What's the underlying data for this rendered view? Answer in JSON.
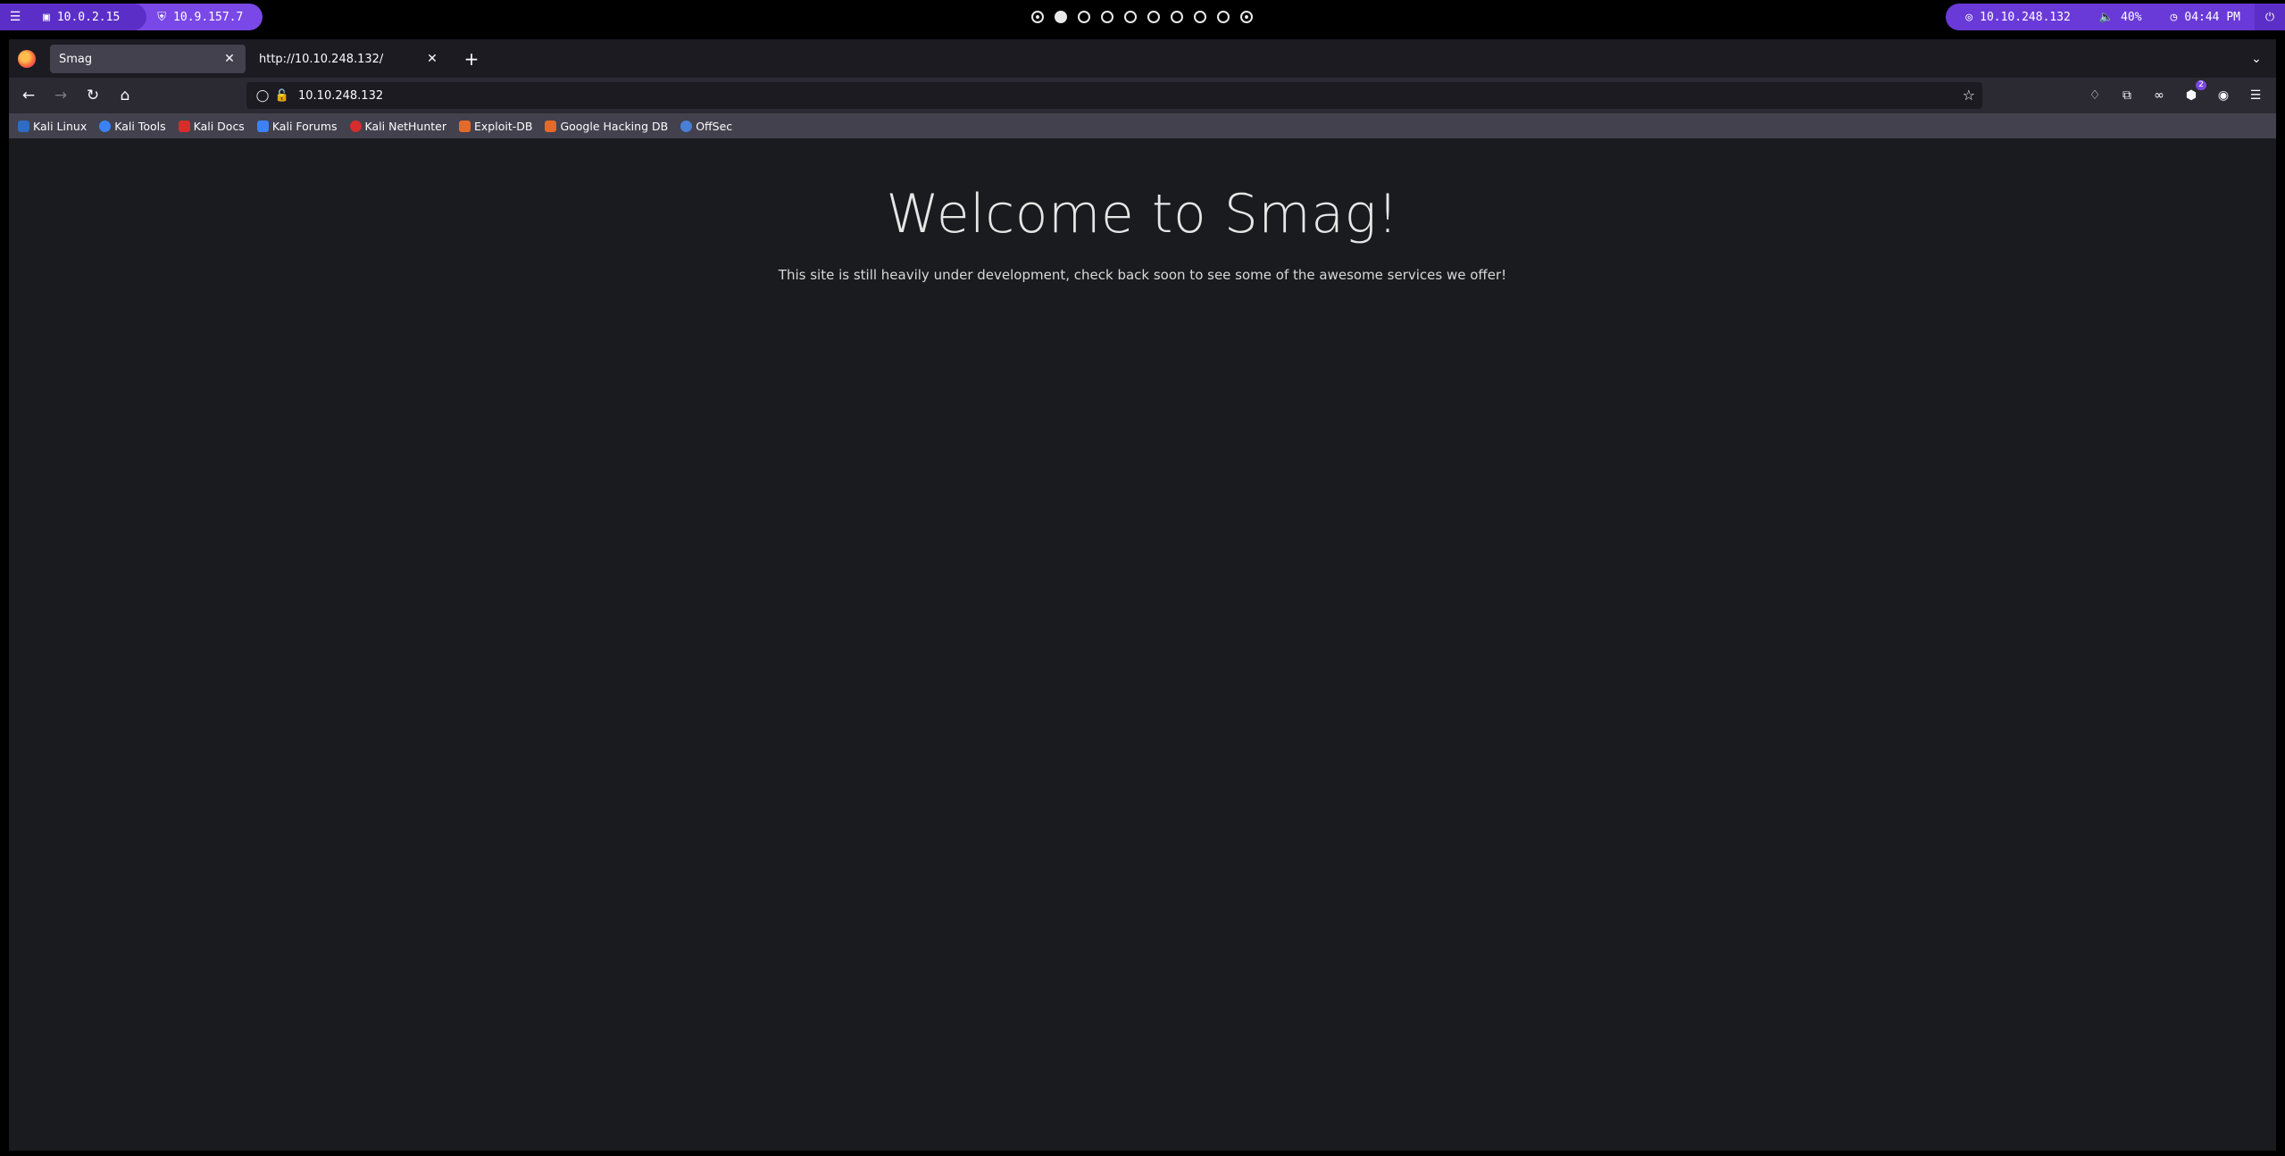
{
  "system_bar": {
    "local_ip": "10.0.2.15",
    "vpn_ip": "10.9.157.7",
    "workspaces": [
      "1",
      "2",
      "3",
      "4",
      "5",
      "6",
      "7",
      "8",
      "9",
      "10"
    ],
    "active_workspace": 2,
    "target_ip": "10.10.248.132",
    "volume": "40%",
    "time": "04:44 PM"
  },
  "browser": {
    "tabs": [
      {
        "label": "Smag",
        "active": true
      },
      {
        "label": "http://10.10.248.132/",
        "active": false
      }
    ],
    "url": "10.10.248.132",
    "extension_badge": "2",
    "bookmarks": [
      {
        "label": "Kali Linux",
        "color": "#2c6cc4"
      },
      {
        "label": "Kali Tools",
        "color": "#3b82f6"
      },
      {
        "label": "Kali Docs",
        "color": "#d72c2c"
      },
      {
        "label": "Kali Forums",
        "color": "#3b82f6"
      },
      {
        "label": "Kali NetHunter",
        "color": "#d72c2c"
      },
      {
        "label": "Exploit-DB",
        "color": "#e36a2a"
      },
      {
        "label": "Google Hacking DB",
        "color": "#e36a2a"
      },
      {
        "label": "OffSec",
        "color": "#4a7fd6"
      }
    ]
  },
  "page": {
    "heading": "Welcome to Smag!",
    "text": "This site is still heavily under development, check back soon to see some of the awesome services we offer!"
  }
}
